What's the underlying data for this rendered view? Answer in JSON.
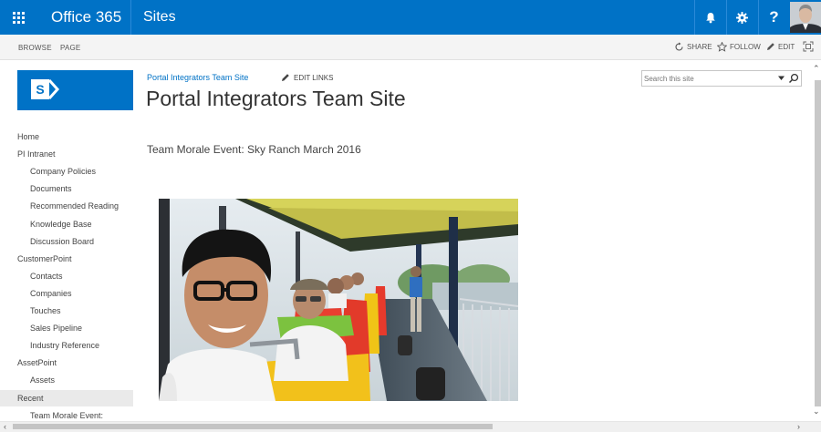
{
  "suite_bar": {
    "brand": "Office 365",
    "app_title": "Sites",
    "help_label": "?",
    "colors": {
      "background": "#0072c6",
      "text": "#ffffff"
    },
    "icons": [
      "app-launcher-icon",
      "bell-icon",
      "gear-icon",
      "help-icon",
      "avatar"
    ]
  },
  "ribbon": {
    "tabs": [
      "BROWSE",
      "PAGE"
    ],
    "actions": {
      "share": "SHARE",
      "follow": "FOLLOW",
      "edit": "EDIT"
    }
  },
  "site": {
    "logo_letter": "S",
    "breadcrumb": "Portal Integrators Team Site",
    "edit_links": "EDIT LINKS",
    "title": "Portal Integrators Team Site"
  },
  "search": {
    "placeholder": "Search this site"
  },
  "nav": {
    "items": [
      {
        "label": "Home",
        "level": 1
      },
      {
        "label": "PI Intranet",
        "level": 1
      },
      {
        "label": "Company Policies",
        "level": 2
      },
      {
        "label": "Documents",
        "level": 2
      },
      {
        "label": "Recommended Reading",
        "level": 2
      },
      {
        "label": "Knowledge Base",
        "level": 2
      },
      {
        "label": "Discussion Board",
        "level": 2
      },
      {
        "label": "CustomerPoint",
        "level": 1
      },
      {
        "label": "Contacts",
        "level": 2
      },
      {
        "label": "Companies",
        "level": 2
      },
      {
        "label": "Touches",
        "level": 2
      },
      {
        "label": "Sales Pipeline",
        "level": 2
      },
      {
        "label": "Industry Reference",
        "level": 2
      },
      {
        "label": "AssetPoint",
        "level": 1
      },
      {
        "label": "Assets",
        "level": 2
      },
      {
        "label": "Recent",
        "level": 1,
        "highlighted": true
      },
      {
        "label": "Team Morale Event:",
        "level": 2
      }
    ]
  },
  "article": {
    "heading": "Team Morale Event: Sky Ranch March 2016",
    "image_alt_subject": "Group selfie on an amusement park train ride"
  }
}
